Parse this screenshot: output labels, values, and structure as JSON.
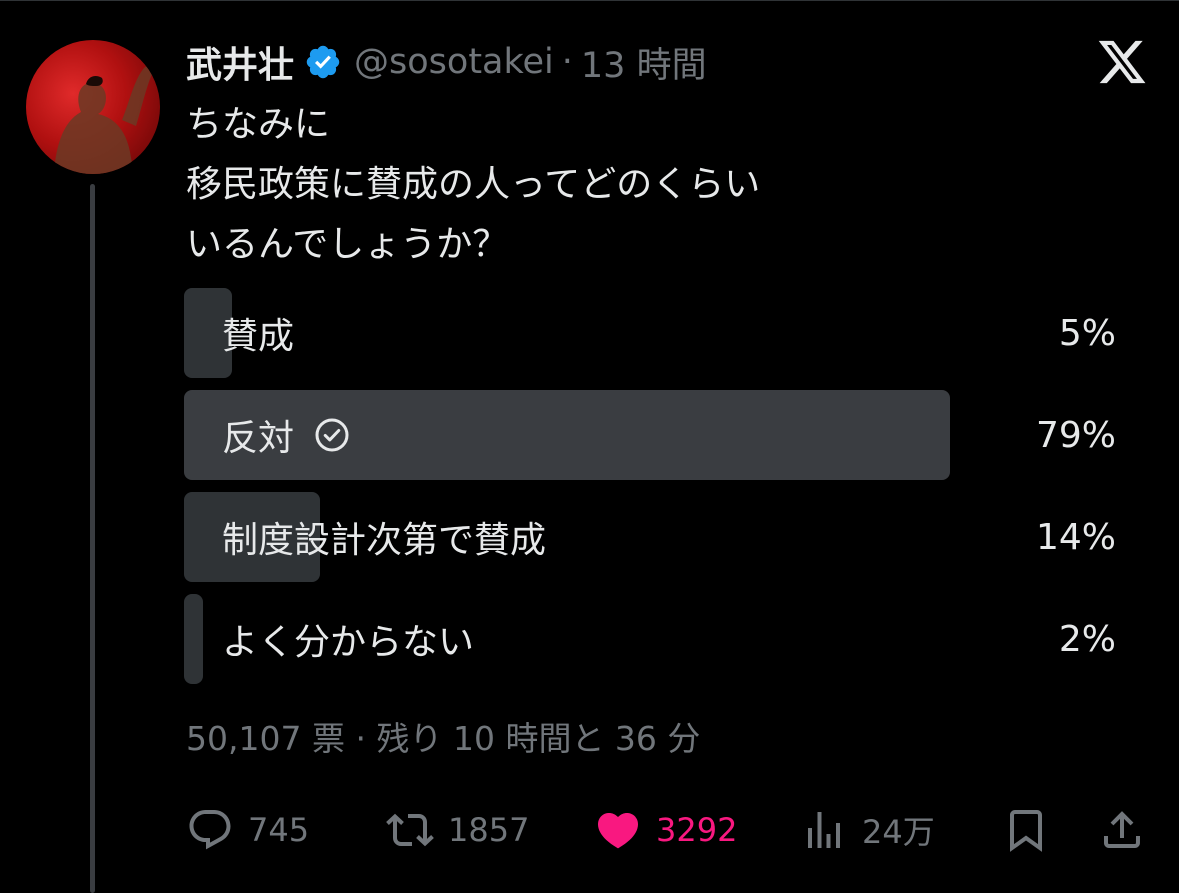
{
  "post": {
    "author_name": "武井壮",
    "handle": "@sosotakei",
    "separator": "·",
    "time": "13 時間",
    "text_lines": [
      "ちなみに",
      "移民政策に賛成の人ってどのくらい",
      "いるんでしょうか？"
    ]
  },
  "poll": {
    "options": [
      {
        "label": "賛成",
        "percent": "5%",
        "value": 5,
        "selected": false
      },
      {
        "label": "反対",
        "percent": "79%",
        "value": 79,
        "selected": true
      },
      {
        "label": "制度設計次第で賛成",
        "percent": "14%",
        "value": 14,
        "selected": false
      },
      {
        "label": "よく分からない",
        "percent": "2%",
        "value": 2,
        "selected": false
      }
    ],
    "votes_text": "50,107 票",
    "separator": "·",
    "remaining_text": "残り 10 時間と 36 分"
  },
  "actions": {
    "replies": "745",
    "reposts": "1857",
    "likes": "3292",
    "views": "24万"
  },
  "icons": {
    "verified": "verified-badge-icon",
    "logo": "x-logo-icon",
    "reply": "reply-icon",
    "repost": "repost-icon",
    "like": "heart-icon",
    "views": "views-icon",
    "bookmark": "bookmark-icon",
    "share": "share-icon",
    "check": "check-circle-icon"
  },
  "colors": {
    "background": "#000000",
    "text": "#e7e9ea",
    "muted": "#71767b",
    "like": "#f91880",
    "verified": "#1d9bf0",
    "poll_fill": "#2f3336"
  }
}
